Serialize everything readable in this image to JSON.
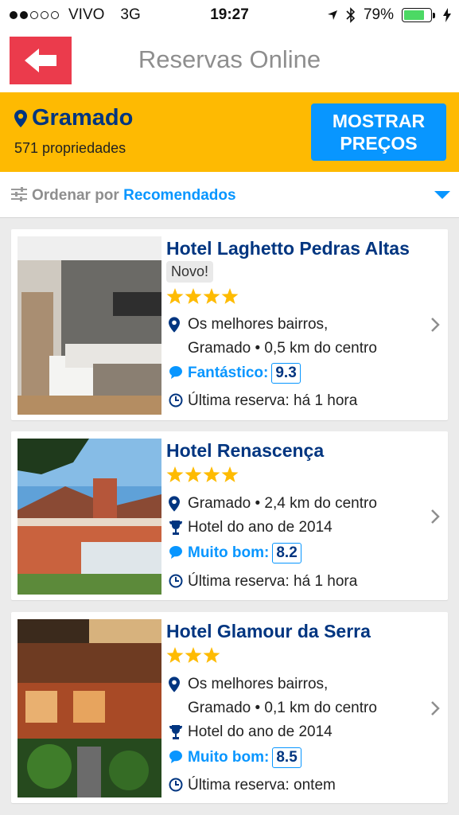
{
  "status_bar": {
    "carrier": "VIVO",
    "network": "3G",
    "time": "19:27",
    "battery": "79%",
    "battery_level": 0.79
  },
  "nav": {
    "title": "Reservas Online"
  },
  "destination": {
    "name": "Gramado",
    "count": "571 propriedades",
    "button_line1": "MOSTRAR",
    "button_line2": "PREÇOS"
  },
  "sort": {
    "label": "Ordenar por",
    "value": "Recomendados"
  },
  "hotels": [
    {
      "name": "Hotel Laghetto Pedras Altas",
      "badge": "Novo!",
      "stars": 4,
      "location_line1": "Os melhores bairros,",
      "location_line2": "Gramado • 0,5 km do centro",
      "score_label": "Fantástico:",
      "score": "9.3",
      "last_booking": "Última reserva: há 1 hora"
    },
    {
      "name": "Hotel Renascença",
      "stars": 4,
      "location_line1": "Gramado • 2,4 km do centro",
      "award": "Hotel do ano de 2014",
      "score_label": "Muito bom:",
      "score": "8.2",
      "last_booking": "Última reserva: há 1 hora"
    },
    {
      "name": "Hotel Glamour da Serra",
      "stars": 3,
      "location_line1": "Os melhores bairros,",
      "location_line2": "Gramado • 0,1 km do centro",
      "award": "Hotel do ano de 2014",
      "score_label": "Muito bom:",
      "score": "8.5",
      "last_booking": "Última reserva: ontem"
    }
  ],
  "icons": [
    "back-arrow-icon",
    "location-pin-icon",
    "sort-sliders-icon",
    "caret-down-icon",
    "star-icon",
    "trophy-icon",
    "speech-bubble-icon",
    "clock-icon",
    "chevron-right-icon"
  ],
  "colors": {
    "accent_yellow": "#feba02",
    "brand_blue": "#003580",
    "action_blue": "#0896ff",
    "back_red": "#eb3b4c",
    "star_gold": "#febb02"
  }
}
